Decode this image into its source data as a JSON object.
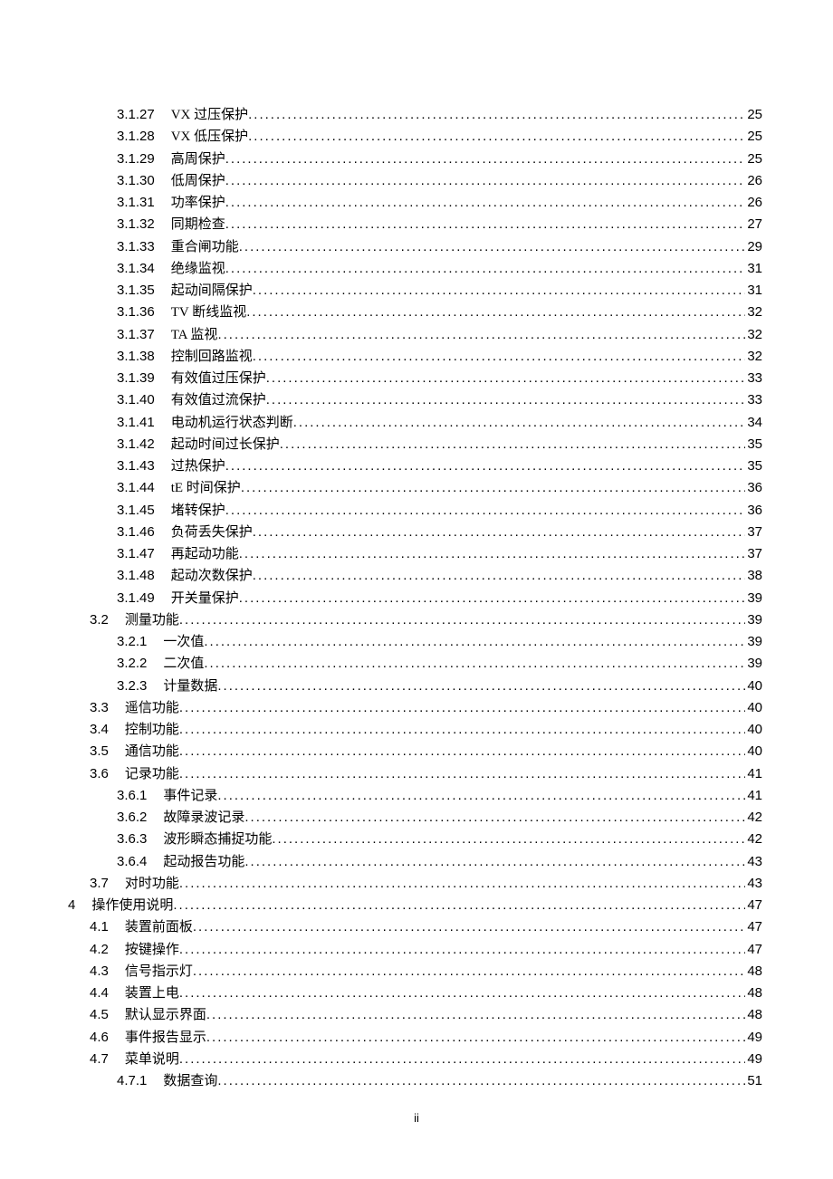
{
  "page_number_label": "ii",
  "toc": [
    {
      "lvl": 3,
      "num": "3.1.27",
      "title": "VX 过压保护",
      "pg": "25"
    },
    {
      "lvl": 3,
      "num": "3.1.28",
      "title": "VX 低压保护",
      "pg": "25"
    },
    {
      "lvl": 3,
      "num": "3.1.29",
      "title": "高周保护",
      "pg": "25"
    },
    {
      "lvl": 3,
      "num": "3.1.30",
      "title": "低周保护",
      "pg": "26"
    },
    {
      "lvl": 3,
      "num": "3.1.31",
      "title": "功率保护",
      "pg": "26"
    },
    {
      "lvl": 3,
      "num": "3.1.32",
      "title": "同期检查",
      "pg": "27"
    },
    {
      "lvl": 3,
      "num": "3.1.33",
      "title": "重合闸功能",
      "pg": "29"
    },
    {
      "lvl": 3,
      "num": "3.1.34",
      "title": "绝缘监视",
      "pg": "31"
    },
    {
      "lvl": 3,
      "num": "3.1.35",
      "title": "起动间隔保护",
      "pg": "31"
    },
    {
      "lvl": 3,
      "num": "3.1.36",
      "title": "TV 断线监视",
      "pg": "32"
    },
    {
      "lvl": 3,
      "num": "3.1.37",
      "title": "TA 监视",
      "pg": "32"
    },
    {
      "lvl": 3,
      "num": "3.1.38",
      "title": "控制回路监视",
      "pg": "32"
    },
    {
      "lvl": 3,
      "num": "3.1.39",
      "title": "有效值过压保护",
      "pg": "33"
    },
    {
      "lvl": 3,
      "num": "3.1.40",
      "title": "有效值过流保护",
      "pg": "33"
    },
    {
      "lvl": 3,
      "num": "3.1.41",
      "title": "电动机运行状态判断",
      "pg": "34"
    },
    {
      "lvl": 3,
      "num": "3.1.42",
      "title": "起动时间过长保护",
      "pg": "35"
    },
    {
      "lvl": 3,
      "num": "3.1.43",
      "title": "过热保护",
      "pg": "35"
    },
    {
      "lvl": 3,
      "num": "3.1.44",
      "title": "tE 时间保护",
      "pg": "36"
    },
    {
      "lvl": 3,
      "num": "3.1.45",
      "title": "堵转保护",
      "pg": "36"
    },
    {
      "lvl": 3,
      "num": "3.1.46",
      "title": "负荷丢失保护",
      "pg": "37"
    },
    {
      "lvl": 3,
      "num": "3.1.47",
      "title": "再起动功能",
      "pg": "37"
    },
    {
      "lvl": 3,
      "num": "3.1.48",
      "title": "起动次数保护",
      "pg": "38"
    },
    {
      "lvl": 3,
      "num": "3.1.49",
      "title": "开关量保护",
      "pg": "39"
    },
    {
      "lvl": 2,
      "num": "3.2",
      "title": "测量功能",
      "pg": "39"
    },
    {
      "lvl": 3,
      "num": "3.2.1",
      "title": "一次值",
      "pg": "39"
    },
    {
      "lvl": 3,
      "num": "3.2.2",
      "title": "二次值",
      "pg": "39"
    },
    {
      "lvl": 3,
      "num": "3.2.3",
      "title": "计量数据",
      "pg": "40"
    },
    {
      "lvl": 2,
      "num": "3.3",
      "title": "遥信功能",
      "pg": "40"
    },
    {
      "lvl": 2,
      "num": "3.4",
      "title": "控制功能",
      "pg": "40"
    },
    {
      "lvl": 2,
      "num": "3.5",
      "title": "通信功能",
      "pg": "40"
    },
    {
      "lvl": 2,
      "num": "3.6",
      "title": "记录功能",
      "pg": "41"
    },
    {
      "lvl": 3,
      "num": "3.6.1",
      "title": "事件记录",
      "pg": "41"
    },
    {
      "lvl": 3,
      "num": "3.6.2",
      "title": "故障录波记录",
      "pg": "42"
    },
    {
      "lvl": 3,
      "num": "3.6.3",
      "title": "波形瞬态捕捉功能",
      "pg": "42"
    },
    {
      "lvl": 3,
      "num": "3.6.4",
      "title": "起动报告功能",
      "pg": "43"
    },
    {
      "lvl": 2,
      "num": "3.7",
      "title": "对时功能",
      "pg": "43"
    },
    {
      "lvl": 1,
      "num": "4",
      "title": "操作使用说明",
      "pg": "47"
    },
    {
      "lvl": 2,
      "num": "4.1",
      "title": "装置前面板",
      "pg": "47"
    },
    {
      "lvl": 2,
      "num": "4.2",
      "title": "按键操作",
      "pg": "47"
    },
    {
      "lvl": 2,
      "num": "4.3",
      "title": "信号指示灯",
      "pg": "48"
    },
    {
      "lvl": 2,
      "num": "4.4",
      "title": "装置上电",
      "pg": "48"
    },
    {
      "lvl": 2,
      "num": "4.5",
      "title": "默认显示界面",
      "pg": "48"
    },
    {
      "lvl": 2,
      "num": "4.6",
      "title": "事件报告显示",
      "pg": "49"
    },
    {
      "lvl": 2,
      "num": "4.7",
      "title": "菜单说明",
      "pg": "49"
    },
    {
      "lvl": 3,
      "num": "4.7.1",
      "title": "数据查询",
      "pg": "51"
    }
  ]
}
